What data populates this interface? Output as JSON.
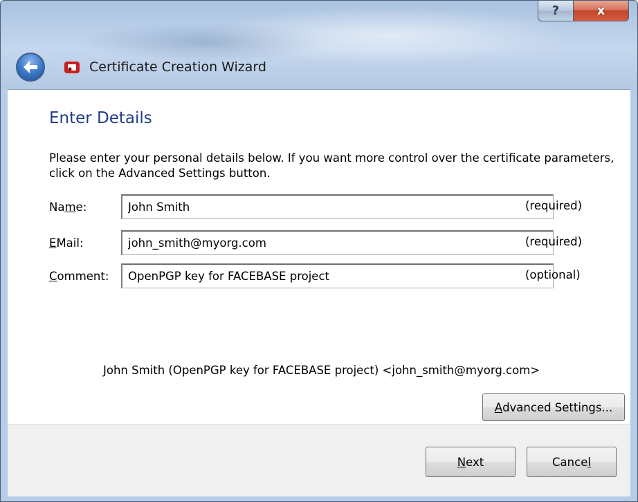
{
  "window": {
    "title": "Certificate Creation Wizard",
    "help_glyph": "?",
    "close_glyph": "x"
  },
  "page": {
    "heading": "Enter Details",
    "intro": "Please enter your personal details below. If you want more control over the certificate parameters, click on the Advanced Settings button."
  },
  "fields": {
    "name": {
      "label_pre": "Na",
      "label_key": "m",
      "label_post": "e:",
      "value": "John Smith",
      "note": "(required)"
    },
    "email": {
      "label_pre": "",
      "label_key": "E",
      "label_post": "Mail:",
      "value": "john_smith@myorg.com",
      "note": "(required)"
    },
    "comment": {
      "label_pre": "",
      "label_key": "C",
      "label_post": "omment:",
      "value": "OpenPGP key for FACEBASE project",
      "note": "(optional)"
    }
  },
  "summary": "John Smith (OpenPGP key for FACEBASE project) <john_smith@myorg.com>",
  "buttons": {
    "advanced": {
      "key": "A",
      "rest": "dvanced Settings..."
    },
    "next": {
      "key": "N",
      "rest": "ext"
    },
    "cancel": {
      "pre": "Cance",
      "key": "l"
    }
  },
  "icons": {
    "back": "back-arrow-icon",
    "app": "certificate-app-icon"
  },
  "colors": {
    "heading": "#1f3c88",
    "close_button": "#c2462a"
  }
}
